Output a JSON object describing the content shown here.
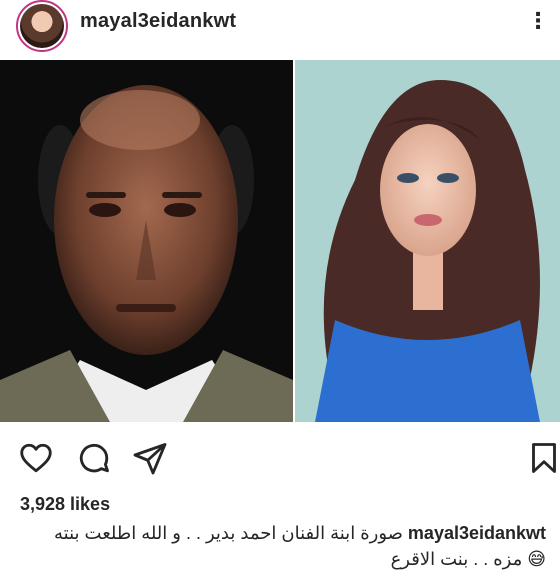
{
  "post": {
    "username": "mayal3eidankwt",
    "more_label": "⋮",
    "likes": "3,928 likes",
    "caption_user": "mayal3eidankwt",
    "caption_line1": "صورة ابنة الفنان احمد بدير . . و الله اطلعت بنته",
    "caption_line2": "😅 مزه . . بنت الاقرع"
  },
  "icons": [
    "like-icon",
    "comment-icon",
    "share-icon",
    "save-icon"
  ],
  "colors": {
    "text": "#262626",
    "accent": "#c13584"
  }
}
